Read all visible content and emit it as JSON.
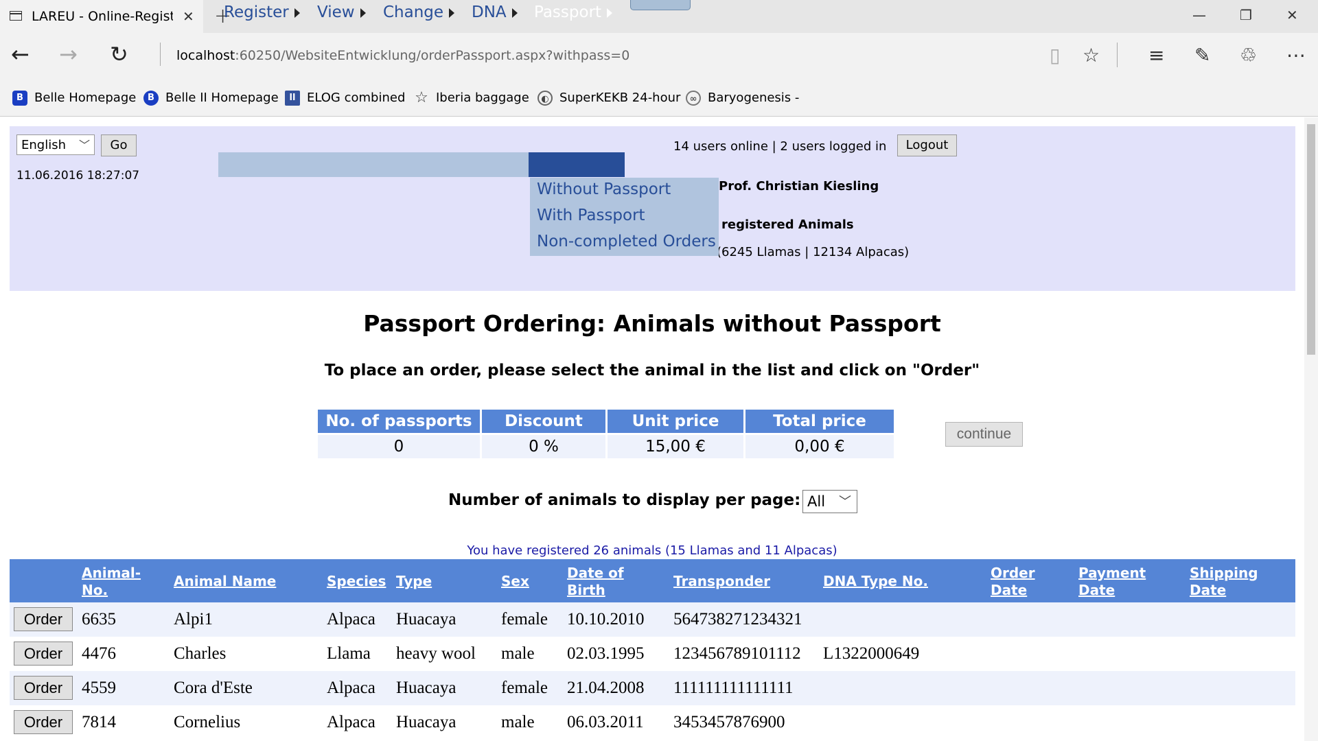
{
  "browser": {
    "tab_title": "LAREU - Online-Registration",
    "tab_close": "✕",
    "new_tab": "+",
    "url_host": "localhost",
    "url_path": ":60250/WebsiteEntwicklung/orderPassport.aspx?withpass=0",
    "favorites": [
      {
        "label": "Belle Homepage",
        "icon": "belle-icon"
      },
      {
        "label": "Belle II Homepage",
        "icon": "belle2-icon"
      },
      {
        "label": "ELOG combined",
        "icon": "elog-icon"
      },
      {
        "label": "Iberia baggage",
        "icon": "star-outline-icon"
      },
      {
        "label": "SuperKEKB 24-hour",
        "icon": "superkekb-icon"
      },
      {
        "label": "Baryogenesis -",
        "icon": "baryogenesis-icon"
      }
    ]
  },
  "header": {
    "language": "English",
    "go_label": "Go",
    "datetime": "11.06.2016 18:27:07",
    "menu": [
      {
        "label": "Register"
      },
      {
        "label": "View"
      },
      {
        "label": "Change"
      },
      {
        "label": "DNA"
      },
      {
        "label": "Passport"
      }
    ],
    "passport_submenu": [
      "Without Passport",
      "With Passport",
      "Non-completed Orders"
    ],
    "users_online": "14 users online | 2 users logged in",
    "logout_label": "Logout",
    "user_name": "Prof. Christian Kiesling",
    "registered_animals": "registered Animals",
    "animal_counts": "(6245 Llamas | 12134 Alpacas)"
  },
  "main": {
    "title": "Passport Ordering: Animals without Passport",
    "instruction": "To place an order, please select the animal in the list and click on \"Order\"",
    "price_table": {
      "headers": [
        "No. of passports",
        "Discount",
        "Unit price",
        "Total price"
      ],
      "values": [
        "0",
        "0 %",
        "15,00 €",
        "0,00 €"
      ]
    },
    "continue_label": "continue",
    "per_page_label": "Number of animals to display per page:",
    "per_page_value": "All",
    "registered_summary": "You have registered 26 animals (15 Llamas and 11 Alpacas)"
  },
  "grid": {
    "headers": {
      "animal_no": [
        "Animal-",
        "No."
      ],
      "animal_name": "Animal Name",
      "species": "Species",
      "type": "Type",
      "sex": "Sex",
      "dob": [
        "Date of",
        "Birth"
      ],
      "transponder": "Transponder",
      "dna_type_no": "DNA Type No.",
      "order_date": [
        "Order",
        "Date"
      ],
      "payment_date": [
        "Payment",
        "Date"
      ],
      "shipping_date": [
        "Shipping",
        "Date"
      ]
    },
    "order_label": "Order",
    "rows": [
      {
        "no": "6635",
        "name": "Alpi1",
        "species": "Alpaca",
        "type": "Huacaya",
        "sex": "female",
        "dob": "10.10.2010",
        "transponder": "564738271234321",
        "dna": ""
      },
      {
        "no": "4476",
        "name": "Charles",
        "species": "Llama",
        "type": "heavy wool",
        "sex": "male",
        "dob": "02.03.1995",
        "transponder": "123456789101112",
        "dna": "L1322000649"
      },
      {
        "no": "4559",
        "name": "Cora d'Este",
        "species": "Alpaca",
        "type": "Huacaya",
        "sex": "female",
        "dob": "21.04.2008",
        "transponder": "111111111111111",
        "dna": ""
      },
      {
        "no": "7814",
        "name": "Cornelius",
        "species": "Alpaca",
        "type": "Huacaya",
        "sex": "male",
        "dob": "06.03.2011",
        "transponder": "3453457876900",
        "dna": ""
      }
    ]
  }
}
